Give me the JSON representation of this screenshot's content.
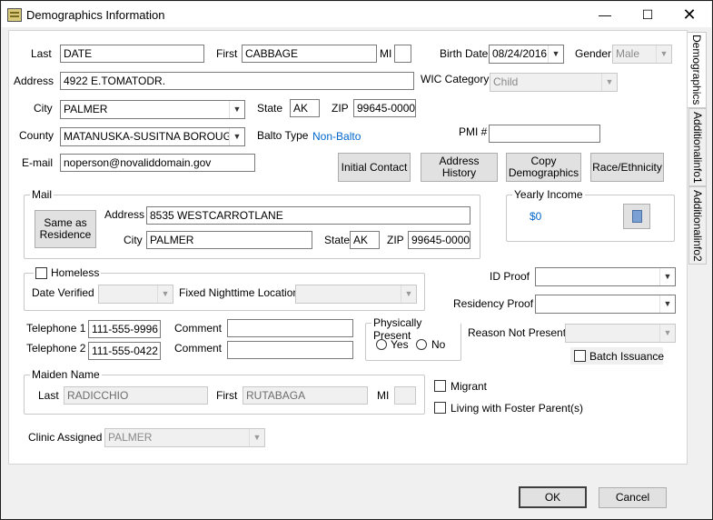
{
  "window": {
    "title": "Demographics Information"
  },
  "labels": {
    "last": "Last",
    "first": "First",
    "mi": "MI",
    "birth_date": "Birth Date",
    "gender": "Gender",
    "address": "Address",
    "wic_category": "WIC Category",
    "city": "City",
    "state": "State",
    "zip": "ZIP",
    "county": "County",
    "balto_type": "Balto Type",
    "pmi": "PMI #",
    "email": "E-mail",
    "telephone1": "Telephone 1",
    "telephone2": "Telephone 2",
    "comment": "Comment",
    "reason_not_present": "Reason Not Present",
    "clinic_assigned": "Clinic Assigned",
    "id_proof": "ID Proof",
    "residency_proof": "Residency Proof"
  },
  "fields": {
    "last": "DATE",
    "first": "CABBAGE",
    "mi": "",
    "birth_date": "08/24/2016",
    "gender": "Male",
    "address": "4922 E.TOMATODR.",
    "wic_category": "Child",
    "city": "PALMER",
    "state": "AK",
    "zip": "99645-0000",
    "county": "MATANUSKA-SUSITNA BOROUGH",
    "balto_type": "Non-Balto",
    "pmi": "",
    "email": "noperson@novaliddomain.gov",
    "telephone1": "111-555-9996",
    "telephone2": "111-555-0422",
    "comment1": "",
    "comment2": "",
    "reason_not_present": "",
    "clinic_assigned": "PALMER",
    "id_proof": "",
    "residency_proof": ""
  },
  "buttons": {
    "initial_contact": "Initial Contact",
    "address_history": "Address History",
    "copy_demographics": "Copy Demographics",
    "race_ethnicity": "Race/Ethnicity",
    "same_as_residence": "Same as Residence",
    "ok": "OK",
    "cancel": "Cancel"
  },
  "mail": {
    "title": "Mail",
    "address_label": "Address",
    "address": "8535 WESTCARROTLANE",
    "city_label": "City",
    "city": "PALMER",
    "state_label": "State",
    "state": "AK",
    "zip_label": "ZIP",
    "zip": "99645-0000"
  },
  "yearly_income": {
    "title": "Yearly Income",
    "value": "$0"
  },
  "homeless": {
    "label": "Homeless",
    "date_verified_label": "Date Verified",
    "date_verified": "",
    "fixed_nighttime_label": "Fixed Nighttime Location",
    "fixed_nighttime": ""
  },
  "physically_present": {
    "title": "Physically Present",
    "yes": "Yes",
    "no": "No"
  },
  "batch_issuance": "Batch Issuance",
  "maiden_name": {
    "title": "Maiden Name",
    "last_label": "Last",
    "last": "RADICCHIO",
    "first_label": "First",
    "first": "RUTABAGA",
    "mi_label": "MI",
    "mi": ""
  },
  "migrant": "Migrant",
  "foster": "Living with Foster Parent(s)",
  "tabs": [
    "Demographics",
    "Additionalinfo1",
    "Additionalinfo2"
  ],
  "icons": {
    "app": "app-icon",
    "calculator": "calculator-icon",
    "dropdown": "chevron-down-icon"
  }
}
